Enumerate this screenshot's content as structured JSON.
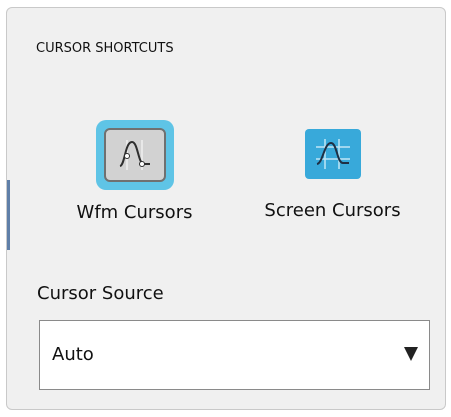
{
  "panel": {
    "title": "CURSOR SHORTCUTS"
  },
  "shortcuts": [
    {
      "label": "Wfm Cursors",
      "icon": "waveform-cursors-icon",
      "selected": true
    },
    {
      "label": "Screen Cursors",
      "icon": "screen-cursors-icon",
      "selected": false
    }
  ],
  "cursor_source": {
    "label": "Cursor Source",
    "value": "Auto"
  },
  "colors": {
    "selected_highlight": "#5fc4e6",
    "screen_icon_bg": "#38a9da",
    "panel_bg": "#f0f0f0"
  }
}
